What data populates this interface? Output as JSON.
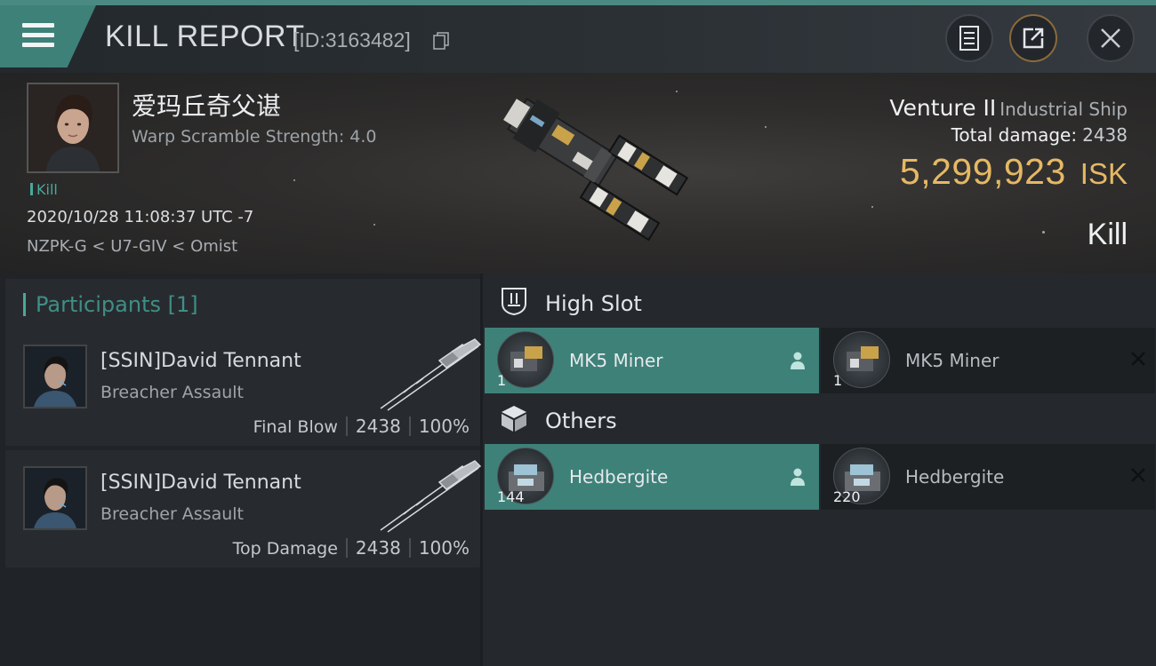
{
  "header": {
    "title": "KILL REPORT",
    "report_id": "[ID:3163482]",
    "icons": [
      "menu-icon",
      "copy-icon",
      "notes-icon",
      "share-icon",
      "close-icon"
    ],
    "accent_color": "#3e8179"
  },
  "victim": {
    "name": "爱玛丘奇父谌",
    "warp_scramble": "Warp Scramble Strength: 4.0",
    "tag": "Kill",
    "datetime": "2020/10/28 11:08:37 UTC -7",
    "location": "NZPK-G < U7-GIV < Omist"
  },
  "ship": {
    "name": "Venture II",
    "class": "Industrial Ship",
    "total_damage_label": "Total damage:",
    "total_damage": "2438",
    "isk_value": "5,299,923",
    "isk_unit": "ISK",
    "kill_type": "Kill"
  },
  "participants": {
    "header": "Participants [1]",
    "rows": [
      {
        "name": "[SSIN]David Tennant",
        "ship": "Breacher Assault",
        "kind": "Final Blow",
        "damage": "2438",
        "percent": "100%"
      },
      {
        "name": "[SSIN]David Tennant",
        "ship": "Breacher Assault",
        "kind": "Top Damage",
        "damage": "2438",
        "percent": "100%"
      }
    ]
  },
  "slots": {
    "high_slot": {
      "label": "High Slot",
      "items": [
        {
          "name": "MK5 Miner",
          "qty": "1",
          "state": "dropped"
        },
        {
          "name": "MK5 Miner",
          "qty": "1",
          "state": "destroyed"
        }
      ]
    },
    "others": {
      "label": "Others",
      "items": [
        {
          "name": "Hedbergite",
          "qty": "144",
          "state": "dropped"
        },
        {
          "name": "Hedbergite",
          "qty": "220",
          "state": "destroyed"
        }
      ]
    }
  }
}
